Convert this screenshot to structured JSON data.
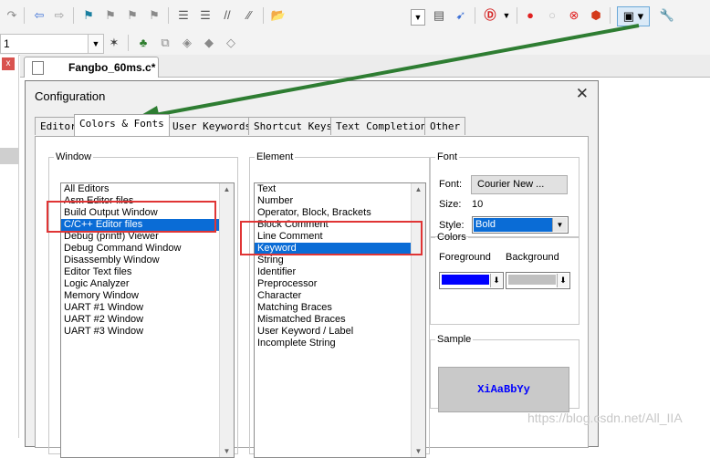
{
  "toolbar": {
    "row1_icons": [
      "redo-icon",
      "back-icon",
      "forward-icon",
      "bookmark-icon",
      "bookmark-prev-icon",
      "bookmark-next-icon",
      "bookmark-clear-icon",
      "indent-icon",
      "unindent-icon",
      "comment-icon",
      "uncomment-icon",
      "find-in-files-icon",
      "find-icon",
      "debug-session-icon",
      "breakpoint-icon",
      "breakpoint-disable-icon",
      "breakpoint-kill-icon",
      "breakpoint-enable-all-icon",
      "window-config-icon",
      "wrench-icon"
    ],
    "row2_field_value": "1"
  },
  "editor": {
    "file_tab": "Fangbo_60ms.c*"
  },
  "dialog": {
    "title": "Configuration",
    "close": "✕",
    "tabs": [
      "Editor",
      "Colors & Fonts",
      "User Keywords",
      "Shortcut Keys",
      "Text Completion",
      "Other"
    ],
    "active_tab": "Colors & Fonts",
    "window_group": {
      "legend": "Window",
      "items": [
        "All Editors",
        "Asm Editor files",
        "Build Output Window",
        "C/C++ Editor files",
        "Debug (printf) Viewer",
        "Debug Command Window",
        "Disassembly Window",
        "Editor Text files",
        "Logic Analyzer",
        "Memory Window",
        "UART #1 Window",
        "UART #2 Window",
        "UART #3 Window"
      ],
      "selected": "C/C++ Editor files"
    },
    "element_group": {
      "legend": "Element",
      "items": [
        "Text",
        "Number",
        "Operator, Block, Brackets",
        "Block Comment",
        "Line Comment",
        "Keyword",
        "String",
        "Identifier",
        "Preprocessor",
        "Character",
        "Matching Braces",
        "Mismatched Braces",
        "User Keyword / Label",
        "Incomplete String"
      ],
      "selected": "Keyword"
    },
    "font_group": {
      "legend": "Font",
      "font_label": "Font:",
      "font_button": "Courier New ...",
      "size_label": "Size:",
      "size_value": "10",
      "style_label": "Style:",
      "style_value": "Bold"
    },
    "colors_group": {
      "legend": "Colors",
      "foreground_label": "Foreground",
      "background_label": "Background",
      "foreground_color": "#0000ff",
      "background_color": "#c0c0c0"
    },
    "sample_group": {
      "legend": "Sample",
      "text": "XiAaBbYy",
      "text_color": "#0000ff"
    }
  },
  "watermark": "https://blog.csdn.net/All_IIA",
  "annotation": {
    "arrow_color": "#2e7d32",
    "box_color": "#e03535"
  }
}
